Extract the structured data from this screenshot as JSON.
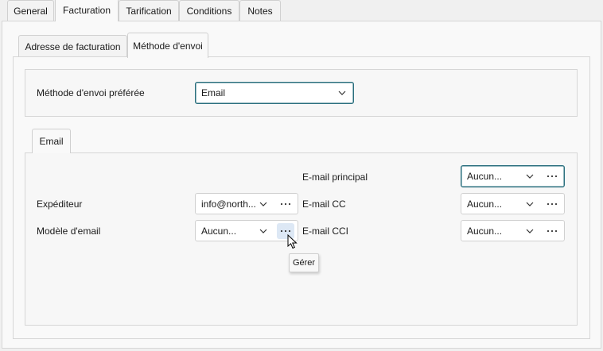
{
  "top_tabs": [
    {
      "label": "General",
      "active": false
    },
    {
      "label": "Facturation",
      "active": true
    },
    {
      "label": "Tarification",
      "active": false
    },
    {
      "label": "Conditions",
      "active": false
    },
    {
      "label": "Notes",
      "active": false
    }
  ],
  "sub_tabs": [
    {
      "label": "Adresse de facturation",
      "active": false
    },
    {
      "label": "Méthode d'envoi",
      "active": true
    }
  ],
  "preferred_method": {
    "label": "Méthode d'envoi préférée",
    "value": "Email"
  },
  "email_tab": {
    "label": "Email"
  },
  "fields": {
    "sender": {
      "label": "Expéditeur",
      "value": "info@north..."
    },
    "template": {
      "label": "Modèle d'email",
      "value": "Aucun..."
    },
    "email_principal": {
      "label": "E-mail principal",
      "value": "Aucun..."
    },
    "email_cc": {
      "label": "E-mail CC",
      "value": "Aucun..."
    },
    "email_cci": {
      "label": "E-mail CCI",
      "value": "Aucun..."
    }
  },
  "tooltip": {
    "text": "Gérer"
  },
  "colors": {
    "focus_border": "#2a6f7e",
    "hover_button": "#dde8f5"
  }
}
